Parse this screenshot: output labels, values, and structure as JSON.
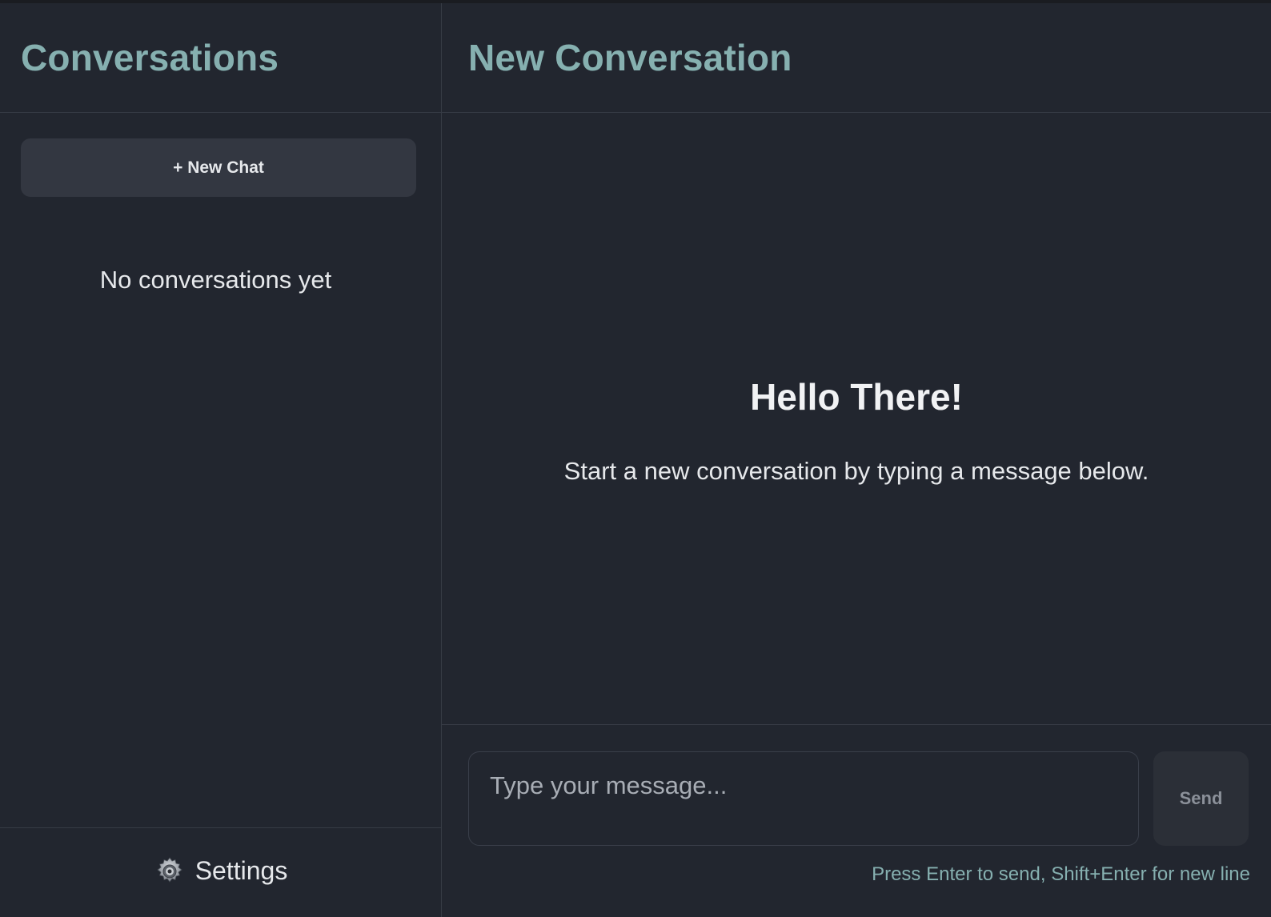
{
  "sidebar": {
    "title": "Conversations",
    "new_chat_label": "+ New Chat",
    "empty_text": "No conversations yet",
    "settings_label": "Settings",
    "settings_icon": "gear-icon"
  },
  "main": {
    "title": "New Conversation",
    "welcome_title": "Hello There!",
    "welcome_subtitle": "Start a new conversation by typing a message below.",
    "input_placeholder": "Type your message...",
    "input_value": "",
    "send_label": "Send",
    "hint": "Press Enter to send, Shift+Enter for new line"
  },
  "colors": {
    "background": "#22262f",
    "accent": "#86b0b0",
    "button": "#333741",
    "border": "#363b45"
  }
}
